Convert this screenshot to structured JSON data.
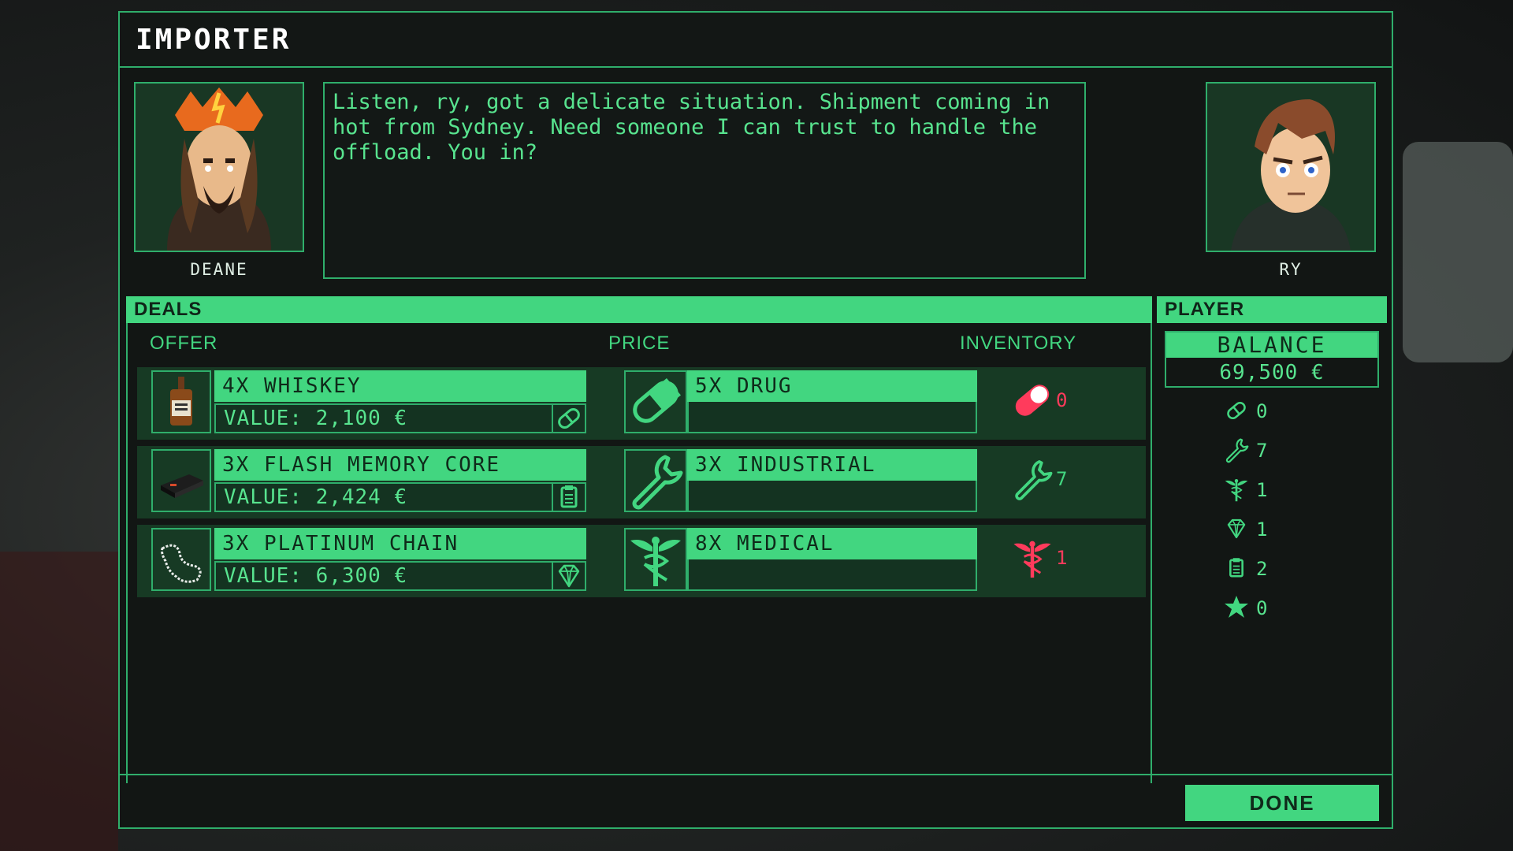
{
  "dialog": {
    "title": "IMPORTER",
    "npc": {
      "name": "DEANE"
    },
    "player_char": {
      "name": "RY"
    },
    "speech": "Listen, ry, got a delicate situation. Shipment coming in hot from Sydney. Need someone I can trust to handle the offload. You in?"
  },
  "deals": {
    "header": "DEALS",
    "columns": {
      "offer": "OFFER",
      "price": "PRICE",
      "inventory": "INVENTORY"
    },
    "rows": [
      {
        "offer_title": "4X WHISKEY",
        "offer_value": "VALUE: 2,100 €",
        "offer_icon": "whiskey-bottle-icon",
        "category_icon": "pill-icon",
        "price_title": "5X DRUG",
        "price_icon": "pill-icon",
        "inventory_count": "0",
        "inventory_color": "#ff3b5c"
      },
      {
        "offer_title": "3X FLASH MEMORY CORE",
        "offer_value": "VALUE: 2,424 €",
        "offer_icon": "memory-core-icon",
        "category_icon": "clipboard-icon",
        "price_title": "3X INDUSTRIAL",
        "price_icon": "wrench-icon",
        "inventory_count": "7",
        "inventory_color": "#42d680"
      },
      {
        "offer_title": "3X PLATINUM CHAIN",
        "offer_value": "VALUE: 6,300 €",
        "offer_icon": "chain-icon",
        "category_icon": "diamond-icon",
        "price_title": "8X MEDICAL",
        "price_icon": "caduceus-icon",
        "inventory_count": "1",
        "inventory_color": "#ff3b5c"
      }
    ]
  },
  "player": {
    "header": "PLAYER",
    "balance_label": "BALANCE",
    "balance_value": "69,500 €",
    "stats": [
      {
        "icon": "pill-icon",
        "count": "0"
      },
      {
        "icon": "wrench-icon",
        "count": "7"
      },
      {
        "icon": "caduceus-icon",
        "count": "1"
      },
      {
        "icon": "diamond-icon",
        "count": "1"
      },
      {
        "icon": "clipboard-icon",
        "count": "2"
      },
      {
        "icon": "star-icon",
        "count": "0"
      }
    ]
  },
  "footer": {
    "done_label": "DONE"
  },
  "colors": {
    "accent": "#42d680",
    "accent_dark": "#2fae6b",
    "alert": "#ff3b5c",
    "panel_bg": "#121614"
  }
}
